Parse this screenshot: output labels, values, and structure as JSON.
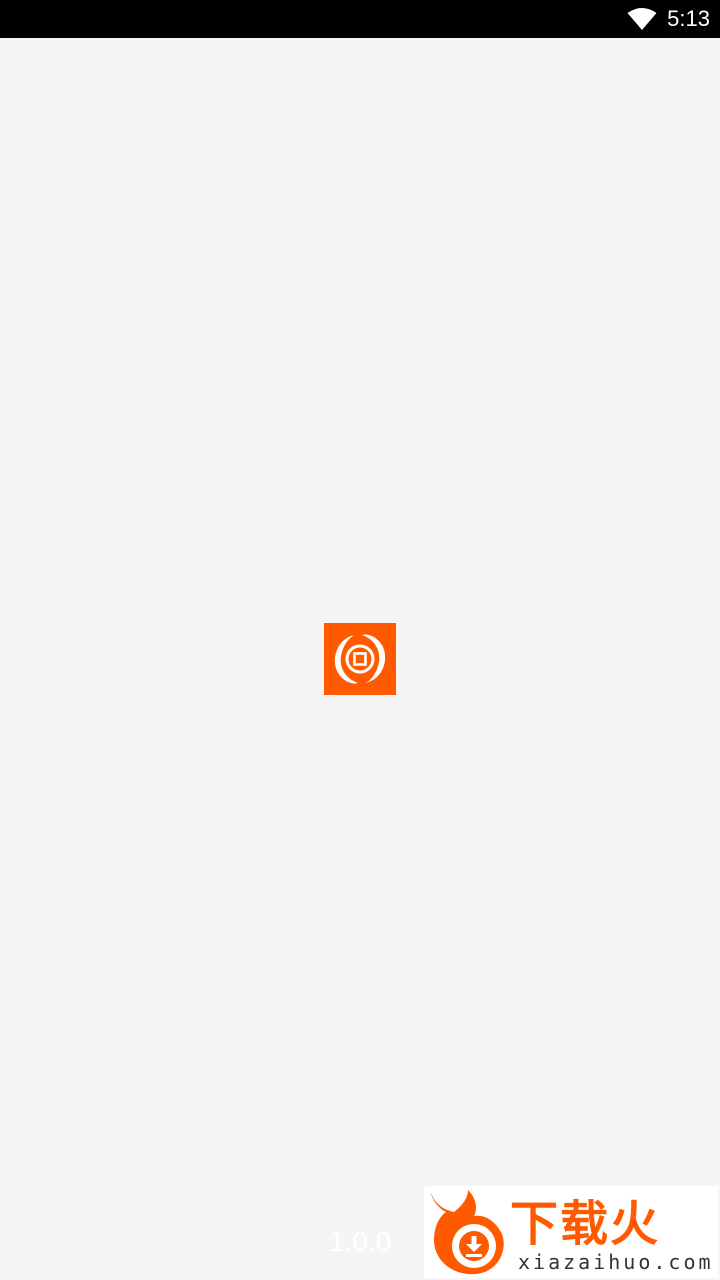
{
  "status_bar": {
    "time": "5:13",
    "wifi_icon": "wifi-icon",
    "background": "#000000"
  },
  "splash": {
    "logo_icon": "app-logo-icon",
    "logo_color": "#ff5a00",
    "background": "#f5f5f5"
  },
  "version": {
    "text": "1.0.0"
  },
  "watermark": {
    "brand_cn": "下载火",
    "brand_en": "xiazaihuo.com",
    "flame_icon": "flame-download-icon",
    "brand_color": "#ff5a00"
  }
}
